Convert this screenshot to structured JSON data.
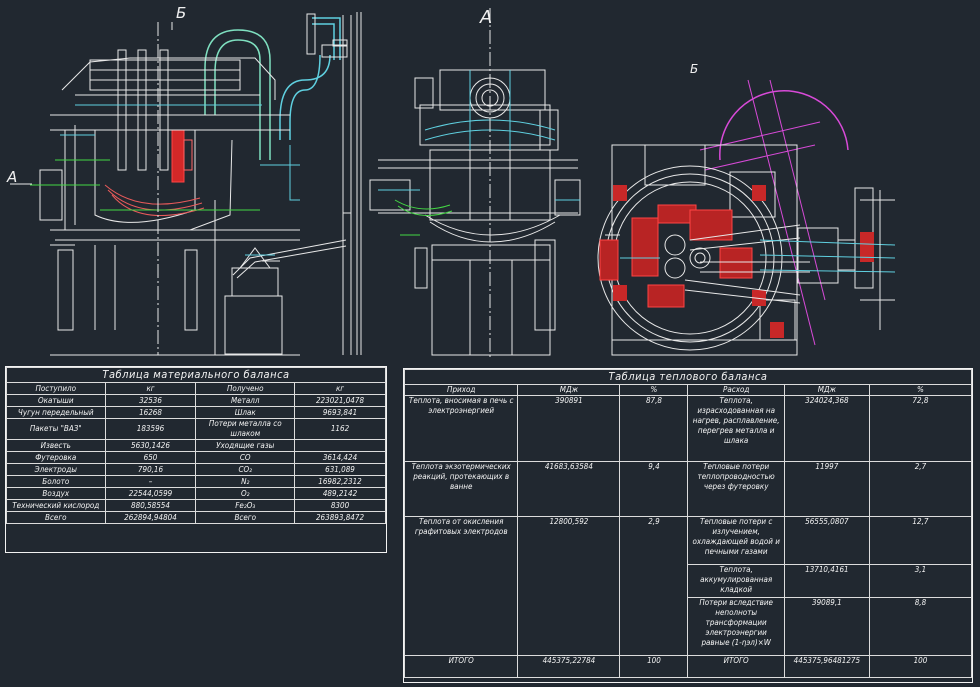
{
  "labels": {
    "section_b_top": "Б",
    "section_a_left": "А",
    "section_a_mid": "А",
    "section_b_right": "Б"
  },
  "material_table": {
    "title": "Таблица материального баланса",
    "headers": [
      "Поступило",
      "кг",
      "Получено",
      "кг"
    ],
    "rows": [
      [
        "Окатыши",
        "32536",
        "Металл",
        "223021,0478"
      ],
      [
        "Чугун передельный",
        "16268",
        "Шлак",
        "9693,841"
      ],
      [
        "Пакеты \"ВАЗ\"",
        "183596",
        "Потери металла со шлаком",
        "1162"
      ],
      [
        "Известь",
        "5630,1426",
        "Уходящие газы",
        ""
      ],
      [
        "Футеровка",
        "650",
        "CO",
        "3614,424"
      ],
      [
        "Электроды",
        "790,16",
        "CO₂",
        "631,089"
      ],
      [
        "Болото",
        "–",
        "N₂",
        "16982,2312"
      ],
      [
        "Воздух",
        "22544,0599",
        "O₂",
        "489,2142"
      ],
      [
        "Технический кислород",
        "880,58554",
        "Fe₂O₃",
        "8300"
      ],
      [
        "Всего",
        "262894,94804",
        "Всего",
        "263893,8472"
      ]
    ]
  },
  "heat_table": {
    "title": "Таблица теплового баланса",
    "headers": [
      "Приход",
      "МДж",
      "%",
      "Расход",
      "МДж",
      "%"
    ],
    "rows": [
      [
        "Теплота, вносимая в печь с электроэнергией",
        "390891",
        "87,8",
        "Теплота, израсходованная на нагрев, расплавление, перегрев металла и шлака",
        "324024,368",
        "72,8"
      ],
      [
        "Теплота экзотермических реакций, протекающих в ванне",
        "41683,63584",
        "9,4",
        "Тепловые потери теплопроводностью через футеровку",
        "11997",
        "2,7"
      ],
      [
        "Теплота от окисления графитовых электродов",
        "12800,592",
        "2,9",
        "Тепловые потери с излучением, охлаждающей водой и печными газами",
        "56555,0807",
        "12,7"
      ],
      [
        "",
        "",
        "",
        "Теплота, аккумулированная кладкой",
        "13710,4161",
        "3,1"
      ],
      [
        "",
        "",
        "",
        "Потери вследствие неполноты трансформации электроэнергии равные (1-ηэл)×W",
        "39089,1",
        "8,8"
      ]
    ],
    "total": [
      "ИТОГО",
      "445375,22784",
      "100",
      "ИТОГО",
      "445375,96481275",
      "100"
    ]
  }
}
